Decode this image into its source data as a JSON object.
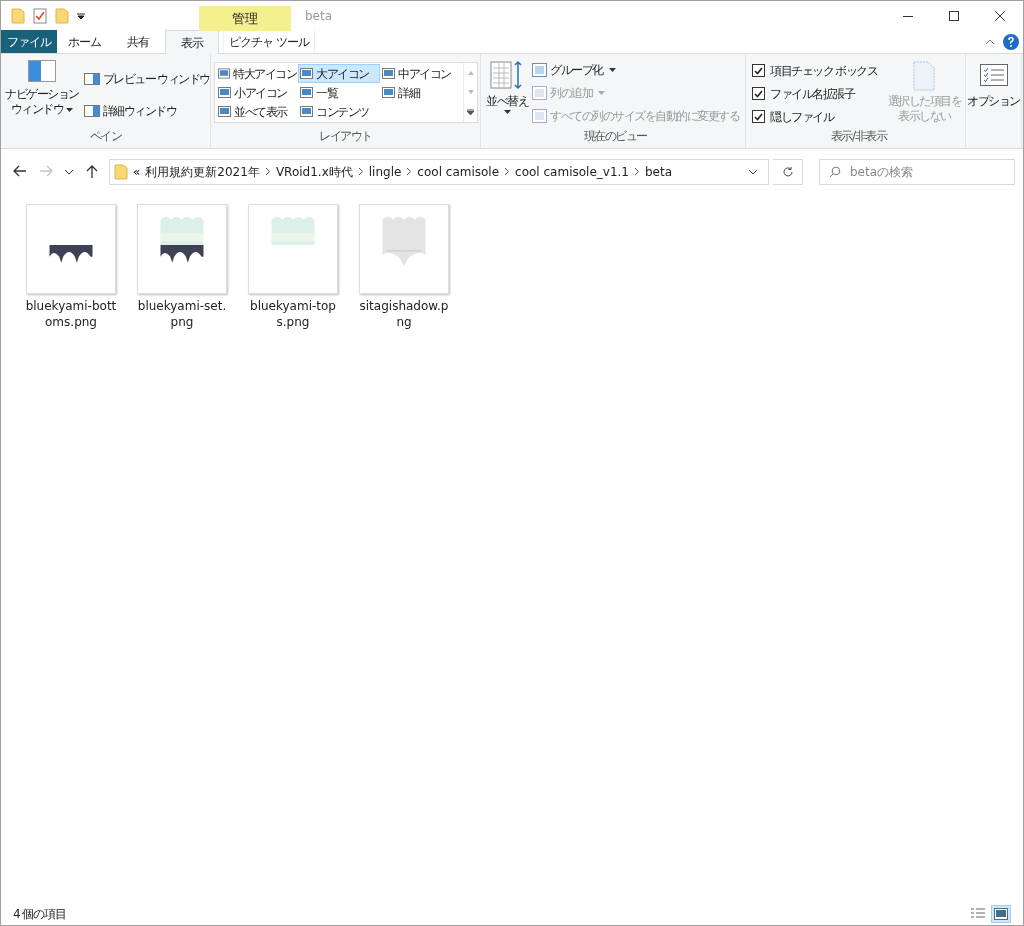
{
  "window": {
    "title": "beta",
    "contextual_header": "管理"
  },
  "tabs": [
    {
      "label": "ファイル",
      "kind": "file",
      "selected": false
    },
    {
      "label": "ホーム",
      "kind": "normal",
      "selected": false
    },
    {
      "label": "共有",
      "kind": "normal",
      "selected": false
    },
    {
      "label": "表示",
      "kind": "normal",
      "selected": true
    },
    {
      "label": "ピクチャ ツール",
      "kind": "contextual",
      "selected": false
    }
  ],
  "pane_group": {
    "label": "ペイン",
    "navigation_pane": [
      "ナビゲーション",
      "ウィンドウ"
    ],
    "commands": [
      "プレビュー ウィンドウ",
      "詳細ウィンドウ"
    ]
  },
  "layout_group": {
    "label": "レイアウト",
    "options": [
      {
        "label": "特大アイコン",
        "selected": false
      },
      {
        "label": "大アイコン",
        "selected": true
      },
      {
        "label": "中アイコン",
        "selected": false
      },
      {
        "label": "小アイコン",
        "selected": false
      },
      {
        "label": "一覧",
        "selected": false
      },
      {
        "label": "詳細",
        "selected": false
      },
      {
        "label": "並べて表示",
        "selected": false
      },
      {
        "label": "コンテンツ",
        "selected": false
      }
    ]
  },
  "current_view_group": {
    "label": "現在のビュー",
    "sort_button": "並べ替え",
    "commands": [
      {
        "label": "グループ化",
        "disabled": false,
        "dropdown": true
      },
      {
        "label": "列の追加",
        "disabled": true,
        "dropdown": true
      },
      {
        "label": "すべての列のサイズを自動的に変更する",
        "disabled": true,
        "dropdown": false
      }
    ]
  },
  "show_hide_group": {
    "label": "表示/非表示",
    "checkboxes": [
      {
        "label": "項目チェック ボックス",
        "checked": true
      },
      {
        "label": "ファイル名拡張子",
        "checked": true
      },
      {
        "label": "隠しファイル",
        "checked": true
      }
    ],
    "hide_selected": {
      "lines": [
        "選択した項目を",
        "表示しない"
      ],
      "disabled": true
    }
  },
  "options_button": "オプション",
  "address_bar": {
    "overflow": "«",
    "crumbs": [
      "利用規約更新2021年",
      "VRoid1.x時代",
      "lingle",
      "cool camisole",
      "cool camisole_v1.1",
      "beta"
    ]
  },
  "search": {
    "placeholder": "betaの検索"
  },
  "nav_buttons": [
    {
      "kind": "back",
      "disabled": false
    },
    {
      "kind": "forward",
      "disabled": true
    },
    {
      "kind": "recent",
      "disabled": false
    },
    {
      "kind": "up",
      "disabled": false
    }
  ],
  "files": [
    {
      "name": "bluekyami-bottoms.png"
    },
    {
      "name": "bluekyami-set.png"
    },
    {
      "name": "bluekyami-tops.png"
    },
    {
      "name": "sitagishadow.png"
    }
  ],
  "status_bar": {
    "count": "4 個の項目"
  },
  "view_buttons": [
    {
      "kind": "details",
      "selected": false
    },
    {
      "kind": "large_icons",
      "selected": true
    }
  ]
}
